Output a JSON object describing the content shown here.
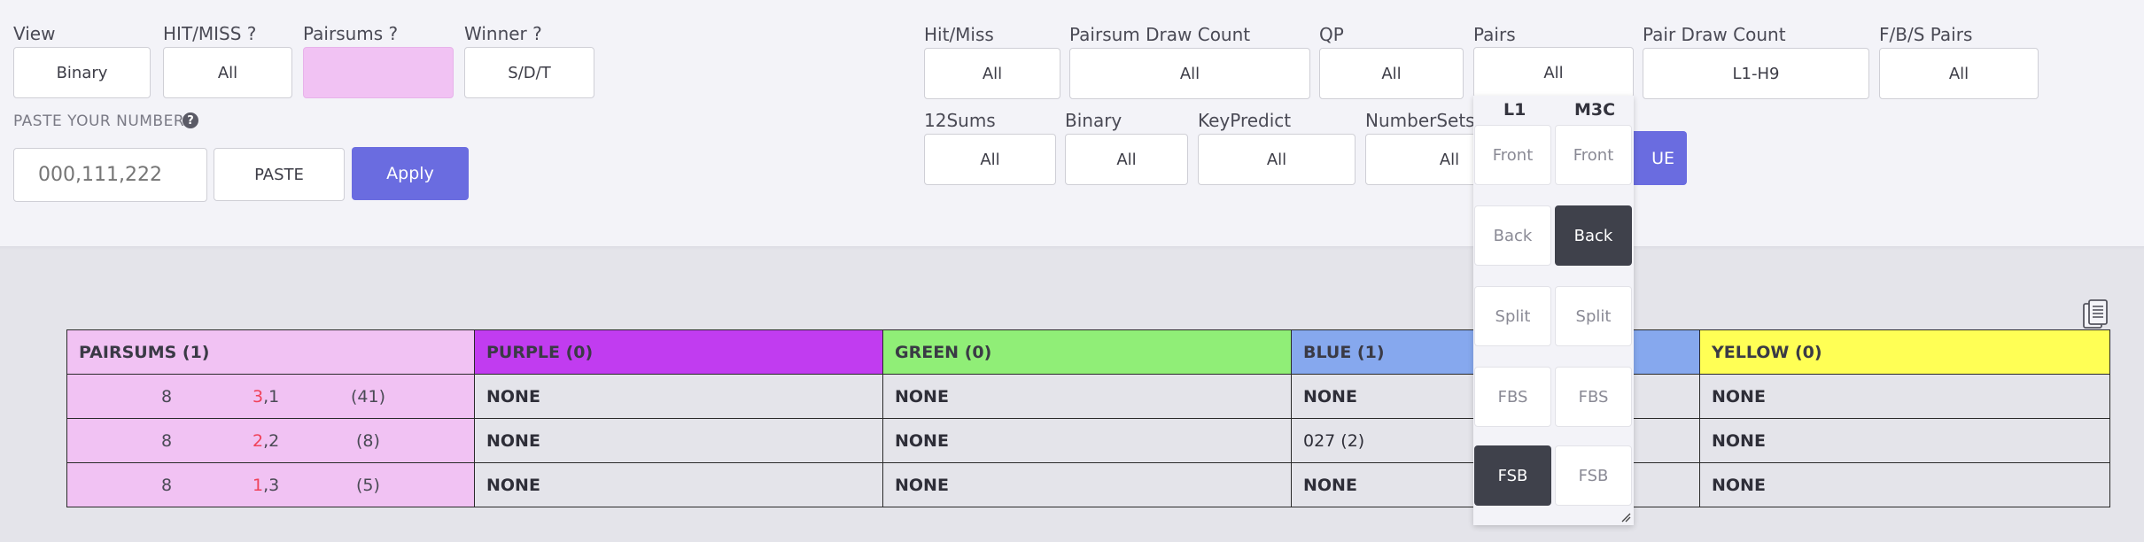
{
  "filters_left": {
    "view": {
      "label": "View",
      "value": "Binary"
    },
    "hitmiss": {
      "label": "HIT/MISS ?",
      "value": "All"
    },
    "pairsums": {
      "label": "Pairsums ?",
      "value": ""
    },
    "winner": {
      "label": "Winner ?",
      "value": "S/D/T"
    },
    "paste_label": "PASTE YOUR NUMBERS",
    "help_icon": "?",
    "numbers_placeholder": "000,111,222",
    "paste_button": "PASTE",
    "apply_button": "Apply"
  },
  "filters_right": [
    {
      "label": "Hit/Miss",
      "value": "All"
    },
    {
      "label": "Pairsum Draw Count",
      "value": "All"
    },
    {
      "label": "QP",
      "value": "All"
    },
    {
      "label": "Pairs",
      "value": "All"
    },
    {
      "label": "Pair Draw Count",
      "value": "L1-H9"
    },
    {
      "label": "F/B/S Pairs",
      "value": "All"
    },
    {
      "label": "12Sums",
      "value": "All"
    },
    {
      "label": "Binary",
      "value": "All"
    },
    {
      "label": "KeyPredict",
      "value": "All"
    },
    {
      "label": "NumberSets",
      "value": "All"
    },
    {
      "label": "partial_button",
      "value": "UE"
    }
  ],
  "pairs_dropdown": {
    "col1_header": "L1",
    "col2_header": "M3C",
    "options": [
      {
        "l1": "Front",
        "m3c": "Front"
      },
      {
        "l1": "Back",
        "m3c": "Back"
      },
      {
        "l1": "Split",
        "m3c": "Split"
      },
      {
        "l1": "FBS",
        "m3c": "FBS"
      },
      {
        "l1": "FSB",
        "m3c": "FSB"
      }
    ],
    "selected": [
      "m3c-Back",
      "l1-FSB"
    ]
  },
  "colors": {
    "purple": "#c13cf0",
    "green": "#90ee77",
    "blue": "#86a8ee",
    "yellow": "#ffff55",
    "pink": "#f1c2f3",
    "accent": "#6a6ce0"
  },
  "table": {
    "headers": [
      "PAIRSUMS (1)",
      "PURPLE (0)",
      "GREEN (0)",
      "BLUE (1)",
      "YELLOW (0)"
    ],
    "rows": [
      {
        "sum": "8",
        "a": "3",
        "b": ",1",
        "count": "(41)",
        "purple": "NONE",
        "green": "NONE",
        "blue": "NONE",
        "yellow": "NONE"
      },
      {
        "sum": "8",
        "a": "2",
        "b": ",2",
        "count": "(8)",
        "purple": "NONE",
        "green": "NONE",
        "blue": "027 (2)",
        "yellow": "NONE"
      },
      {
        "sum": "8",
        "a": "1",
        "b": ",3",
        "count": "(5)",
        "purple": "NONE",
        "green": "NONE",
        "blue": "NONE",
        "yellow": "NONE"
      }
    ]
  },
  "copy_icon": "clipboard-icon"
}
